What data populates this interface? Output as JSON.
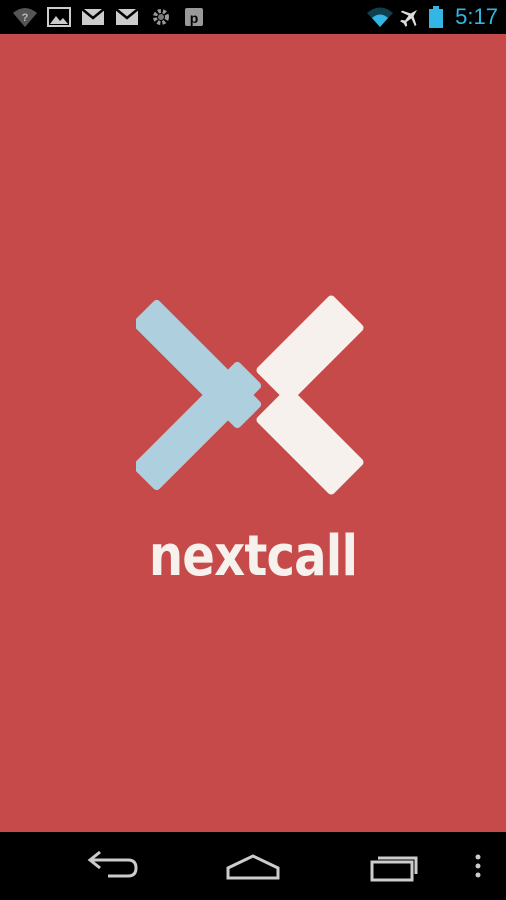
{
  "status_bar": {
    "time": "5:17",
    "left_icons": [
      "wifi-question-icon",
      "image-icon",
      "gmail-icon",
      "gmail-icon",
      "gear-icon",
      "p-icon"
    ],
    "right_icons": [
      "wifi-icon",
      "airplane-icon",
      "battery-icon"
    ],
    "clock_color": "#33b5e5"
  },
  "splash": {
    "background_color": "#c74a4a",
    "app_name": "nextcall",
    "logo_colors": {
      "chevron": "#aecfdd",
      "bars": "#f6f1ec"
    }
  },
  "nav_bar": {
    "buttons": [
      "back-icon",
      "home-icon",
      "recent-apps-icon",
      "overflow-menu-icon"
    ]
  }
}
